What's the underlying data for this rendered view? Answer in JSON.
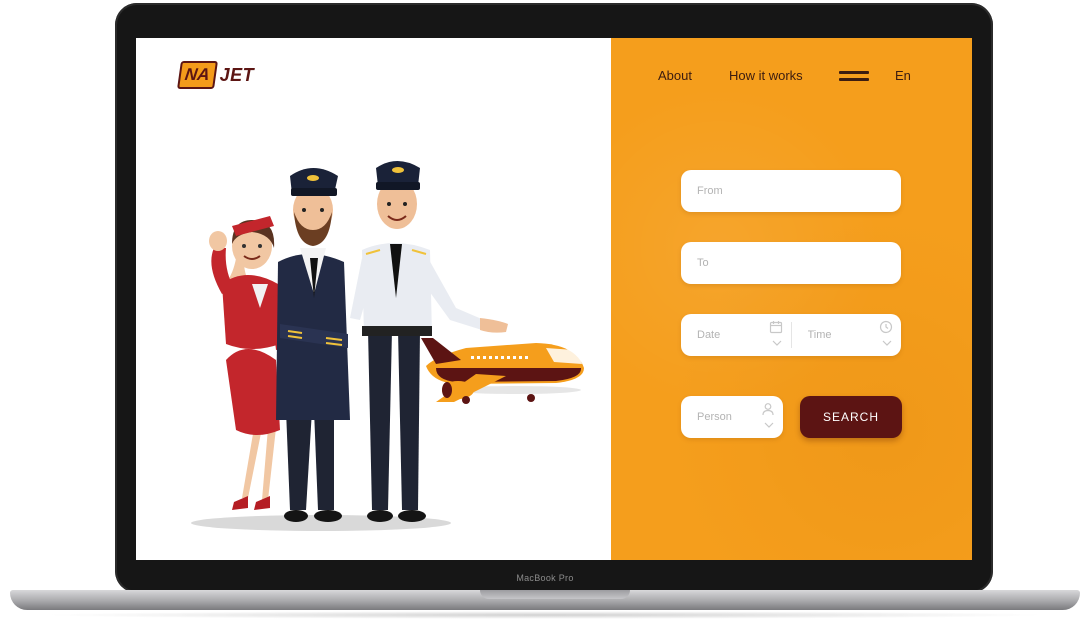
{
  "device": {
    "label": "MacBook Pro"
  },
  "brand": {
    "logo_box": "NA",
    "logo_text": "JET",
    "colors": {
      "accent": "#f59e1c",
      "dark": "#5c1413",
      "text": "#3c1c10"
    }
  },
  "nav": {
    "about": "About",
    "how_it_works": "How it works",
    "menu_icon": "hamburger-icon",
    "language": "En"
  },
  "search_form": {
    "from_placeholder": "From",
    "to_placeholder": "To",
    "date_placeholder": "Date",
    "date_icon": "calendar-icon",
    "time_placeholder": "Time",
    "time_icon": "clock-icon",
    "person_placeholder": "Person",
    "person_icon": "person-icon",
    "search_label": "SEARCH"
  },
  "illustration": {
    "subject": "flight-crew-with-airplane"
  }
}
